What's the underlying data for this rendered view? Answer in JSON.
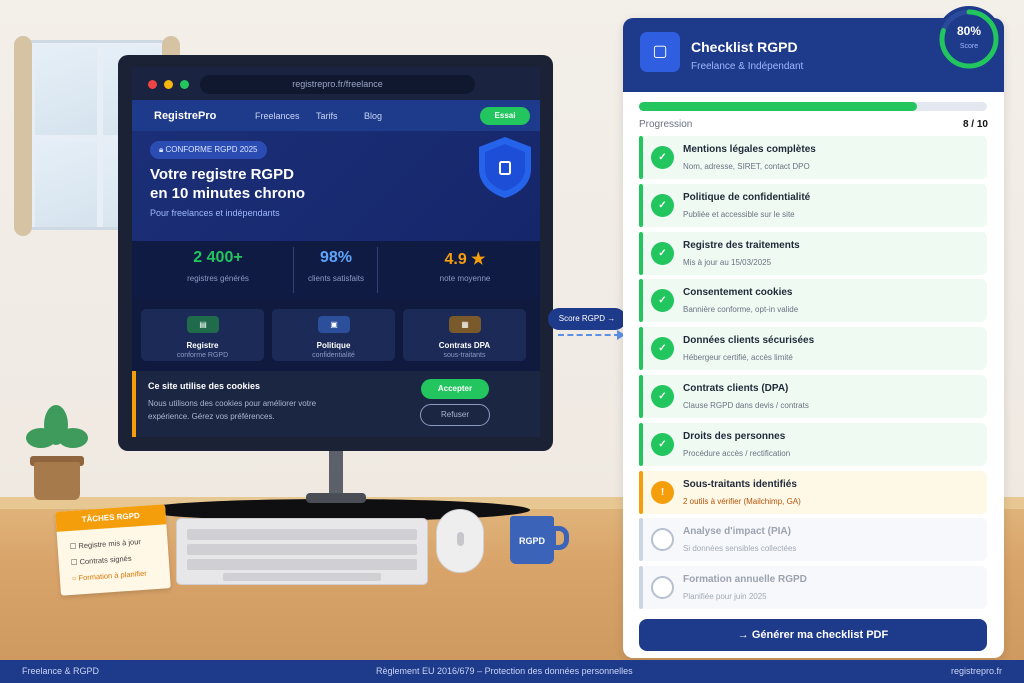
{
  "browser": {
    "url": "registrepro.fr/freelance"
  },
  "site": {
    "brand": "RegistrePro",
    "nav": [
      "Freelances",
      "Tarifs",
      "Blog"
    ],
    "cta": "Essai",
    "badge": "CONFORME RGPD 2025",
    "title_line1": "Votre registre RGPD",
    "title_line2": "en 10 minutes chrono",
    "subtitle": "Pour freelances et indépendants",
    "stats": [
      {
        "value": "2 400+",
        "label": "registres générés",
        "color": "#22c55e"
      },
      {
        "value": "98%",
        "label": "clients satisfaits",
        "color": "#60a5fa"
      },
      {
        "value": "4.9 ★",
        "label": "note moyenne",
        "color": "#f59e0b"
      }
    ],
    "features": [
      {
        "title": "Registre",
        "sub": "conforme RGPD",
        "color": "#1f6b4b"
      },
      {
        "title": "Politique",
        "sub": "confidentialité",
        "color": "#2c4f9b"
      },
      {
        "title": "Contrats DPA",
        "sub": "sous-traitants",
        "color": "#7a5a2b"
      }
    ],
    "cookie": {
      "title": "Ce site utilise des cookies",
      "text": "Nous utilisons des cookies pour améliorer votre expérience. Gérez vos préférences.",
      "accept": "Accepter",
      "refuse": "Refuser"
    }
  },
  "score_pill": "Score RGPD →",
  "note": {
    "title": "TÂCHES RGPD",
    "items": [
      "☐ Registre mis à jour",
      "☐ Contrats signés",
      "○ Formation à planifier"
    ]
  },
  "mug_label": "RGPD",
  "checklist": {
    "title": "Checklist RGPD",
    "subtitle": "Freelance & Indépendant",
    "score": "80%",
    "score_label": "Score",
    "score_fraction": 0.8,
    "progress_label": "Progression",
    "progress_count": "8 / 10",
    "progress_fraction": 0.8,
    "items": [
      {
        "title": "Mentions légales complètes",
        "desc": "Nom, adresse, SIRET, contact DPO",
        "status": "done"
      },
      {
        "title": "Politique de confidentialité",
        "desc": "Publiée et accessible sur le site",
        "status": "done"
      },
      {
        "title": "Registre des traitements",
        "desc": "Mis à jour au 15/03/2025",
        "status": "done"
      },
      {
        "title": "Consentement cookies",
        "desc": "Bannière conforme, opt-in valide",
        "status": "done"
      },
      {
        "title": "Données clients sécurisées",
        "desc": "Hébergeur certifié, accès limité",
        "status": "done"
      },
      {
        "title": "Contrats clients (DPA)",
        "desc": "Clause RGPD dans devis / contrats",
        "status": "done"
      },
      {
        "title": "Droits des personnes",
        "desc": "Procédure accès / rectification",
        "status": "done"
      },
      {
        "title": "Sous-traitants identifiés",
        "desc": "2 outils à vérifier (Mailchimp, GA)",
        "status": "warning"
      },
      {
        "title": "Analyse d'impact (PIA)",
        "desc": "Si données sensibles collectées",
        "status": "todo"
      },
      {
        "title": "Formation annuelle RGPD",
        "desc": "Planifiée pour juin 2025",
        "status": "todo"
      }
    ],
    "button": "→ Générer ma checklist PDF"
  },
  "footer": {
    "left": "Freelance & RGPD",
    "center": "Règlement EU 2016/679 – Protection des données personnelles",
    "right": "registrepro.fr"
  },
  "colors": {
    "accent": "#1e3a8a",
    "success": "#22c55e",
    "warning": "#f59e0b"
  }
}
